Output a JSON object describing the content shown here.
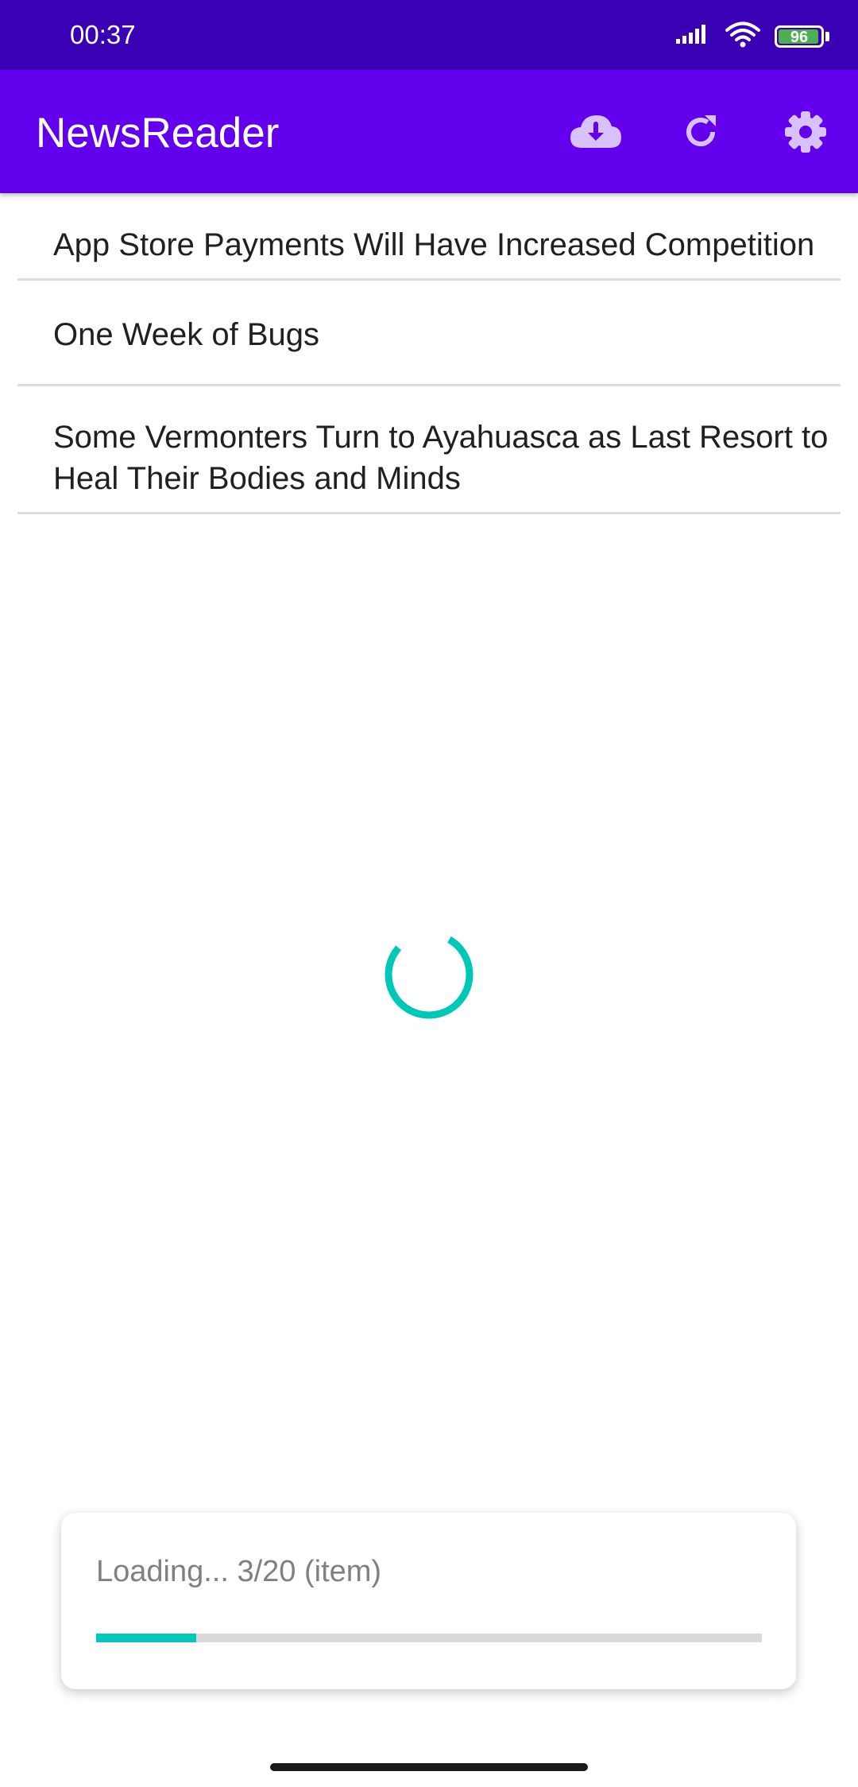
{
  "status_bar": {
    "time": "00:37",
    "battery": "96",
    "icons": [
      "signal-icon",
      "wifi-icon",
      "battery-icon"
    ]
  },
  "app_bar": {
    "title": "NewsReader",
    "actions": [
      "cloud-download-icon",
      "refresh-icon",
      "settings-gear-icon"
    ]
  },
  "articles": [
    {
      "title": "App Store Payments Will Have Increased Competition"
    },
    {
      "title": "One Week of Bugs"
    },
    {
      "title": "Some Vermonters Turn to Ayahuasca as Last Resort to Heal Their Bodies and Minds"
    }
  ],
  "loading": {
    "text": "Loading... 3/20 (item)",
    "progress": 0.15
  },
  "colors": {
    "status_bar": "#3a00b4",
    "app_bar": "#6200ee",
    "accent": "#00c8b8"
  }
}
